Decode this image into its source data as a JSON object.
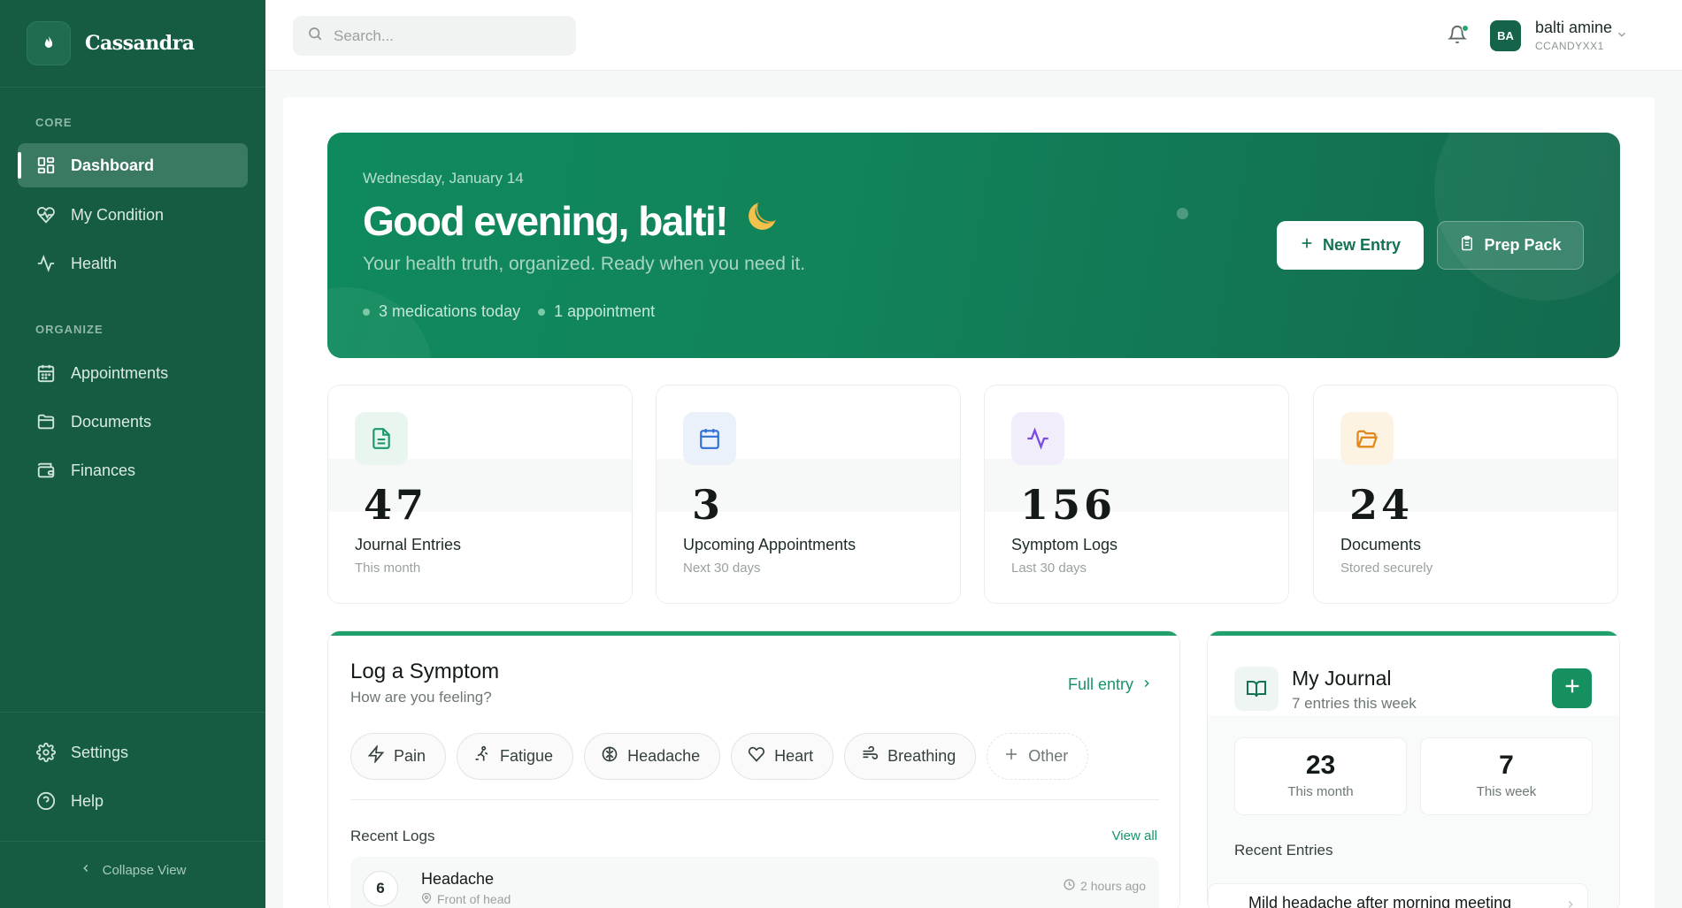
{
  "app": {
    "name": "Cassandra"
  },
  "sidebar": {
    "sections": [
      {
        "label": "CORE"
      },
      {
        "label": "ORGANIZE"
      }
    ],
    "items": [
      {
        "label": "Dashboard",
        "icon": "grid-icon",
        "active": true
      },
      {
        "label": "My Condition",
        "icon": "heart-pulse-icon"
      },
      {
        "label": "Health",
        "icon": "activity-icon"
      },
      {
        "label": "Appointments",
        "icon": "calendar-icon"
      },
      {
        "label": "Documents",
        "icon": "folder-icon"
      },
      {
        "label": "Finances",
        "icon": "wallet-icon"
      },
      {
        "label": "Settings",
        "icon": "gear-icon"
      },
      {
        "label": "Help",
        "icon": "help-circle-icon"
      }
    ],
    "collapse_label": "Collapse View"
  },
  "topbar": {
    "search_placeholder": "Search...",
    "user": {
      "initials": "BA",
      "name": "balti amine",
      "handle": "CCANDYXX1"
    }
  },
  "hero": {
    "date": "Wednesday, January 14",
    "greeting": "Good evening, balti!",
    "subtitle": "Your health truth, organized. Ready when you need it.",
    "meta": [
      "3 medications today",
      "1 appointment"
    ],
    "new_entry_label": "New Entry",
    "prep_pack_label": "Prep Pack"
  },
  "stats": [
    {
      "value": "47",
      "label": "Journal Entries",
      "caption": "This month",
      "icon": "file-text-icon",
      "color": "#1a9a68",
      "bg": "#e9f6f0"
    },
    {
      "value": "3",
      "label": "Upcoming Appointments",
      "caption": "Next 30 days",
      "icon": "calendar-icon",
      "color": "#2f6fd6",
      "bg": "#eaf1fb"
    },
    {
      "value": "156",
      "label": "Symptom Logs",
      "caption": "Last 30 days",
      "icon": "activity-icon",
      "color": "#7a4be0",
      "bg": "#f1edfb"
    },
    {
      "value": "24",
      "label": "Documents",
      "caption": "Stored securely",
      "icon": "folder-open-icon",
      "color": "#e08a1e",
      "bg": "#fdf3e3"
    }
  ],
  "symptom": {
    "title": "Log a Symptom",
    "subtitle": "How are you feeling?",
    "full_entry_label": "Full entry",
    "chips": [
      {
        "label": "Pain",
        "icon": "zap-icon"
      },
      {
        "label": "Fatigue",
        "icon": "fatigue-icon"
      },
      {
        "label": "Headache",
        "icon": "brain-icon"
      },
      {
        "label": "Heart",
        "icon": "heart-icon"
      },
      {
        "label": "Breathing",
        "icon": "wind-icon"
      },
      {
        "label": "Other",
        "icon": "plus-icon"
      }
    ],
    "recent_title": "Recent Logs",
    "view_all_label": "View all",
    "logs": [
      {
        "severity": "6",
        "name": "Headache",
        "location": "Front of head",
        "time": "2 hours ago"
      }
    ]
  },
  "journal": {
    "title": "My Journal",
    "subtitle": "7 entries this week",
    "stats": [
      {
        "value": "23",
        "caption": "This month"
      },
      {
        "value": "7",
        "caption": "This week"
      }
    ],
    "recent_title": "Recent Entries",
    "entries": [
      {
        "title": "Mild headache after morning meeting"
      }
    ]
  },
  "colors": {
    "sidebar_bg": "#155c43",
    "accent": "#1fa06d",
    "hero_start": "#0f8a5d",
    "hero_end": "#136a4f"
  }
}
